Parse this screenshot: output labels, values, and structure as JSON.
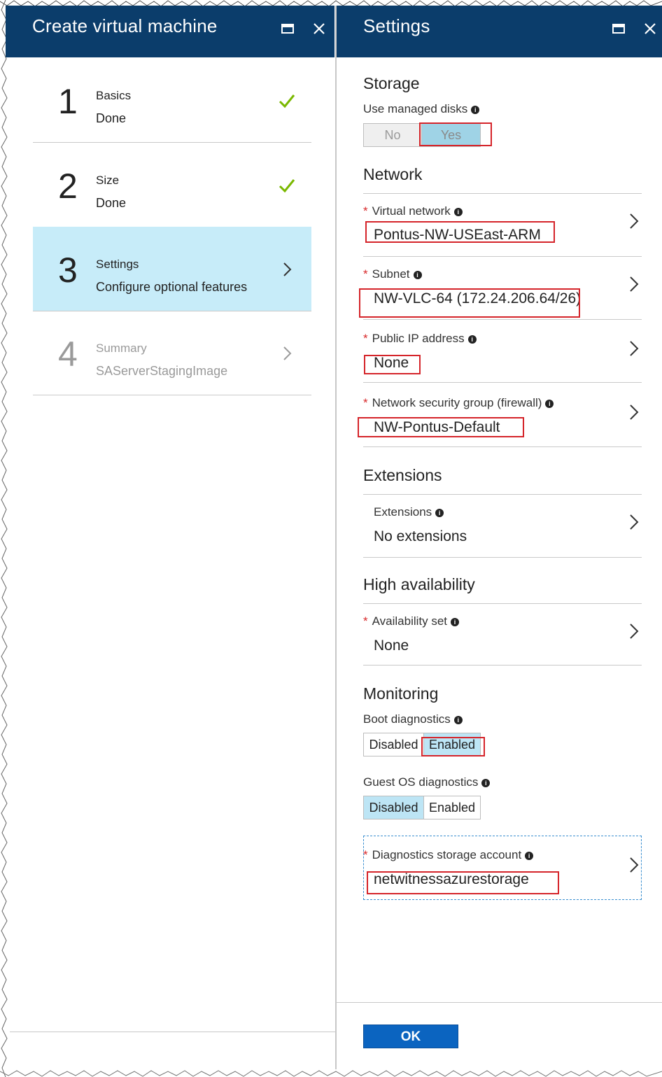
{
  "left_blade": {
    "title": "Create virtual machine",
    "steps": [
      {
        "number": "1",
        "label": "Basics",
        "sub": "Done",
        "status": "check-icon"
      },
      {
        "number": "2",
        "label": "Size",
        "sub": "Done",
        "status": "check-icon"
      },
      {
        "number": "3",
        "label": "Settings",
        "sub": "Configure optional features",
        "status": "chevron-right-icon"
      },
      {
        "number": "4",
        "label": "Summary",
        "sub": "SAServerStagingImage",
        "status": "chevron-right-icon"
      }
    ]
  },
  "right_blade": {
    "title": "Settings",
    "storage": {
      "section": "Storage",
      "managed_disks_label": "Use managed disks",
      "options": [
        "No",
        "Yes"
      ],
      "selected": "Yes"
    },
    "network": {
      "section": "Network",
      "virtual_network": {
        "label": "Virtual network",
        "value": "Pontus-NW-USEast-ARM"
      },
      "subnet": {
        "label": "Subnet",
        "value": "NW-VLC-64 (172.24.206.64/26)"
      },
      "public_ip": {
        "label": "Public IP address",
        "value": "None"
      },
      "nsg": {
        "label": "Network security group (firewall)",
        "value": "NW-Pontus-Default"
      }
    },
    "extensions": {
      "section": "Extensions",
      "label": "Extensions",
      "value": "No extensions"
    },
    "high_availability": {
      "section": "High availability",
      "label": "Availability set",
      "value": "None"
    },
    "monitoring": {
      "section": "Monitoring",
      "boot_diag_label": "Boot diagnostics",
      "boot_options": [
        "Disabled",
        "Enabled"
      ],
      "boot_selected": "Enabled",
      "guest_diag_label": "Guest OS diagnostics",
      "guest_options": [
        "Disabled",
        "Enabled"
      ],
      "guest_selected": "Disabled",
      "storage_label": "Diagnostics storage account",
      "storage_value": "netwitnessazurestorage"
    },
    "ok_label": "OK"
  },
  "colors": {
    "header_bg": "#0b3d6b",
    "active_step_bg": "#c7ecf9",
    "selected_toggle": "#bde5f5",
    "check_green": "#7ab800",
    "required_star": "#d8282a",
    "annotation_red": "#d5242a",
    "ok_button": "#0b64c0"
  }
}
